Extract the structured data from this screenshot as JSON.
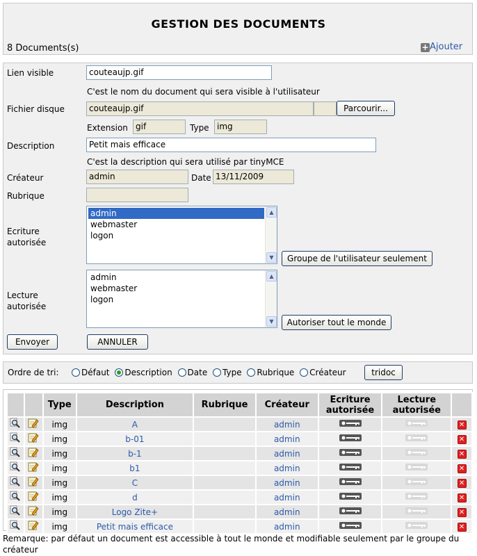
{
  "page_title": "GESTION DES DOCUMENTS",
  "doc_count": "8 Documents(s)",
  "add_link": "Ajouter",
  "form": {
    "lien_visible_label": "Lien visible",
    "lien_visible_value": "couteaujp.gif",
    "lien_visible_hint": "C'est le nom du document qui sera visible à l'utilisateur",
    "fichier_label": "Fichier disque",
    "fichier_value": "couteaujp.gif",
    "browse_label": "Parcourir...",
    "extension_label": "Extension",
    "extension_value": "gif",
    "type_label": "Type",
    "type_value": "img",
    "description_label": "Description",
    "description_value": "Petit mais efficace",
    "description_hint": "C'est la description qui sera utilisé par tinyMCE",
    "createur_label": "Créateur",
    "createur_value": "admin",
    "date_label": "Date",
    "date_value": "13/11/2009",
    "rubrique_label": "Rubrique",
    "rubrique_value": "",
    "ecriture_label_1": "Ecriture",
    "ecriture_label_2": "autorisée",
    "ecriture_options": [
      "admin",
      "webmaster",
      "logon"
    ],
    "ecriture_selected": "admin",
    "groupe_button": "Groupe de l'utilisateur seulement",
    "lecture_label_1": "Lecture",
    "lecture_label_2": "autorisée",
    "lecture_options": [
      "admin",
      "webmaster",
      "logon"
    ],
    "autoriser_button": "Autoriser tout le monde",
    "submit_button": "Envoyer",
    "cancel_button": "ANNULER"
  },
  "sort": {
    "label": "Ordre de tri:",
    "options": [
      "Défaut",
      "Description",
      "Date",
      "Type",
      "Rubrique",
      "Créateur"
    ],
    "selected": "Description",
    "button": "tridoc"
  },
  "table": {
    "headers": {
      "type": "Type",
      "description": "Description",
      "rubrique": "Rubrique",
      "createur": "Créateur",
      "ecriture_1": "Ecriture",
      "ecriture_2": "autorisée",
      "lecture_1": "Lecture",
      "lecture_2": "autorisée"
    },
    "rows": [
      {
        "type": "img",
        "description": "A",
        "rubrique": "",
        "createur": "admin"
      },
      {
        "type": "img",
        "description": "b-01",
        "rubrique": "",
        "createur": "admin"
      },
      {
        "type": "img",
        "description": "b-1",
        "rubrique": "",
        "createur": "admin"
      },
      {
        "type": "img",
        "description": "b1",
        "rubrique": "",
        "createur": "admin"
      },
      {
        "type": "img",
        "description": "C",
        "rubrique": "",
        "createur": "admin"
      },
      {
        "type": "img",
        "description": "d",
        "rubrique": "",
        "createur": "admin"
      },
      {
        "type": "img",
        "description": "Logo Zite+",
        "rubrique": "",
        "createur": "admin"
      },
      {
        "type": "img",
        "description": "Petit mais efficace",
        "rubrique": "",
        "createur": "admin"
      }
    ]
  },
  "remark": "Remarque: par défaut un document est accessible à tout le monde et modifiable seulement par le groupe du créateur",
  "colors": {
    "link": "#2b5aa8",
    "panel_bg": "#f0f0f0",
    "header_bg": "#d3d3d3",
    "key_dark": "#555555",
    "key_light": "#d8d8d8",
    "delete_red": "#e02020"
  },
  "icons": {
    "view": "magnifier-icon",
    "edit": "edit-pencil-icon",
    "write_key": "key-icon",
    "read_key": "key-icon",
    "delete": "delete-x-icon",
    "add": "plus-icon"
  }
}
